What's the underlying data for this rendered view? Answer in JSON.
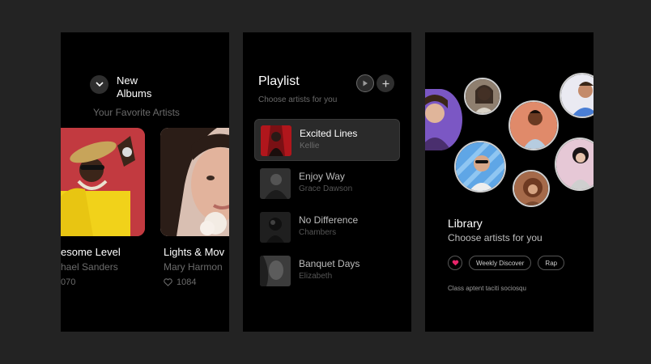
{
  "albums": {
    "title": "New Albums",
    "subtitle": "Your Favorite Artists",
    "cards": [
      {
        "name": "esome Level",
        "artist": "hael Sanders",
        "likes": "070"
      },
      {
        "name": "Lights & Mov",
        "artist": "Mary Harmon",
        "likes": "1084"
      }
    ]
  },
  "playlist": {
    "title": "Playlist",
    "subtitle": "Choose artists for you",
    "tracks": [
      {
        "title": "Excited Lines",
        "artist": "Kellie"
      },
      {
        "title": "Enjoy Way",
        "artist": "Grace Dawson"
      },
      {
        "title": "No Difference",
        "artist": "Chambers"
      },
      {
        "title": "Banquet Days",
        "artist": "Elizabeth"
      }
    ]
  },
  "library": {
    "title": "Library",
    "subtitle": "Choose artists for you",
    "tags": [
      "Weekly Discover",
      "Rap"
    ],
    "footer": "Class aptent taciti sociosqu"
  },
  "icons": {
    "albums_toggle": "chevron-down-icon",
    "play": "play-icon",
    "add": "plus-icon",
    "like": "heart-icon"
  },
  "colors": {
    "background": "#232323",
    "screen": "#000000",
    "muted_text": "#6b6b6b",
    "accent_heart": "#e8246a"
  }
}
